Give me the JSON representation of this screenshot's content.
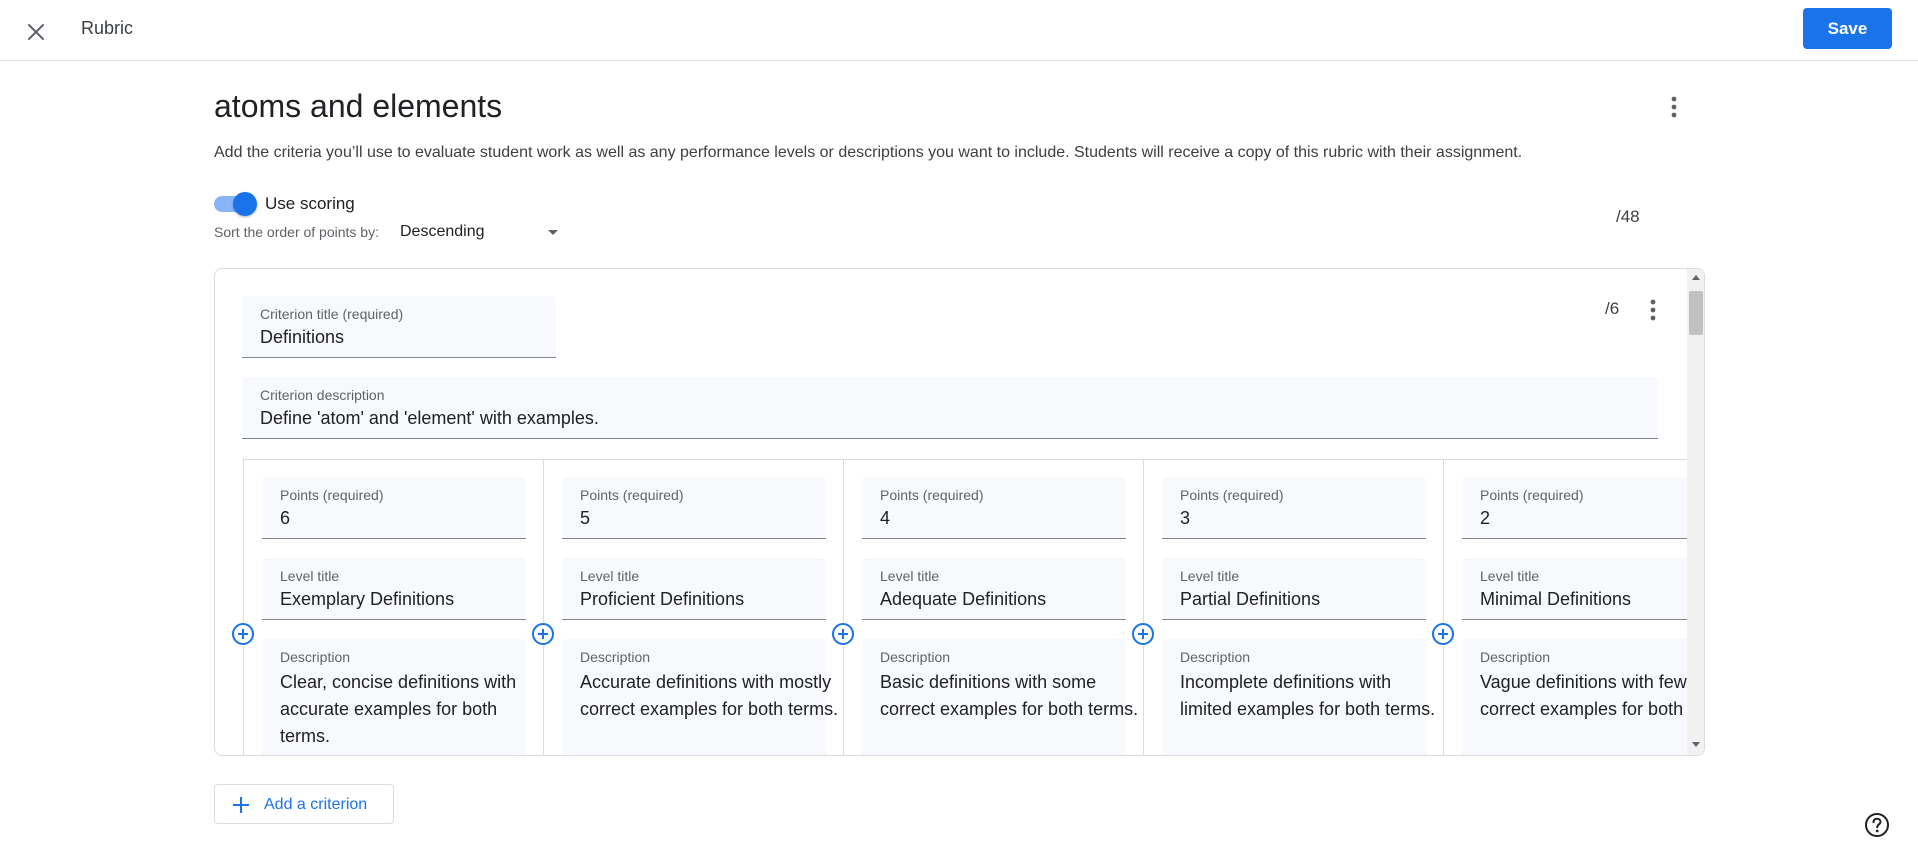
{
  "app": {
    "title": "Rubric",
    "save_label": "Save"
  },
  "rubric": {
    "title": "atoms and elements",
    "instructions": "Add the criteria you’ll use to evaluate student work as well as any performance levels or descriptions you want to include. Students will receive a copy of this rubric with their assignment.",
    "scoring_label": "Use scoring",
    "scoring_enabled": true,
    "sort_label": "Sort the order of points by:",
    "sort_value": "Descending",
    "total_points": "/48"
  },
  "criterion": {
    "title_label": "Criterion title (required)",
    "title_value": "Definitions",
    "desc_label": "Criterion description",
    "desc_value": "Define 'atom' and 'element' with examples.",
    "points": "/6",
    "levels": [
      {
        "points_label": "Points (required)",
        "points": "6",
        "title_label": "Level title",
        "title": "Exemplary Definitions",
        "desc_label": "Description",
        "desc": "Clear, concise definitions with accurate examples for both terms."
      },
      {
        "points_label": "Points (required)",
        "points": "5",
        "title_label": "Level title",
        "title": "Proficient Definitions",
        "desc_label": "Description",
        "desc": "Accurate definitions with mostly correct examples for both terms."
      },
      {
        "points_label": "Points (required)",
        "points": "4",
        "title_label": "Level title",
        "title": "Adequate Definitions",
        "desc_label": "Description",
        "desc": "Basic definitions with some correct examples for both terms."
      },
      {
        "points_label": "Points (required)",
        "points": "3",
        "title_label": "Level title",
        "title": "Partial Definitions",
        "desc_label": "Description",
        "desc": "Incomplete definitions with limited examples for both terms."
      },
      {
        "points_label": "Points (required)",
        "points": "2",
        "title_label": "Level title",
        "title": "Minimal Definitions",
        "desc_label": "Description",
        "desc": "Vague definitions with few correct examples for both terms."
      }
    ]
  },
  "add_criterion_label": "Add a criterion",
  "icons": {
    "close": "close-icon",
    "more": "more-vert-icon",
    "add_level": "add-circle-icon",
    "add": "plus-icon",
    "help": "help-icon"
  },
  "colors": {
    "accent": "#1a73e8",
    "toggle_track": "#8ab4f8"
  }
}
